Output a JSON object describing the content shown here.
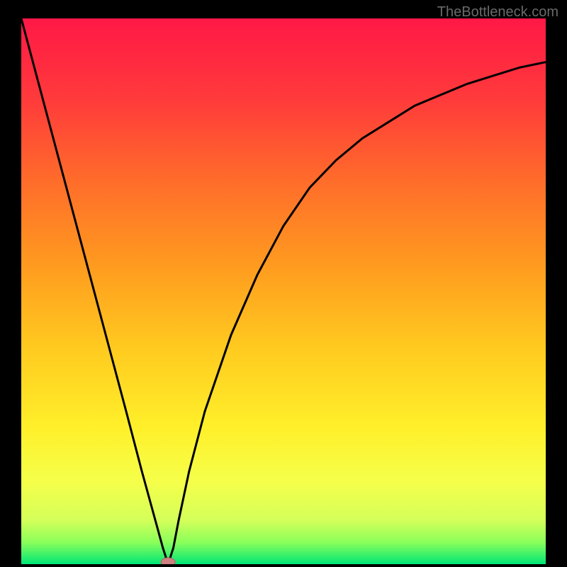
{
  "watermark": "TheBottleneck.com",
  "chart_data": {
    "type": "line",
    "title": "",
    "xlabel": "",
    "ylabel": "",
    "x_range": [
      0,
      100
    ],
    "y_range": [
      0,
      100
    ],
    "curve_points": [
      {
        "x": 0,
        "y": 100
      },
      {
        "x": 5,
        "y": 82
      },
      {
        "x": 10,
        "y": 64
      },
      {
        "x": 15,
        "y": 46
      },
      {
        "x": 20,
        "y": 28
      },
      {
        "x": 23,
        "y": 17
      },
      {
        "x": 25,
        "y": 10
      },
      {
        "x": 27,
        "y": 3
      },
      {
        "x": 28,
        "y": 0
      },
      {
        "x": 29,
        "y": 3
      },
      {
        "x": 30,
        "y": 8
      },
      {
        "x": 32,
        "y": 17
      },
      {
        "x": 35,
        "y": 28
      },
      {
        "x": 40,
        "y": 42
      },
      {
        "x": 45,
        "y": 53
      },
      {
        "x": 50,
        "y": 62
      },
      {
        "x": 55,
        "y": 69
      },
      {
        "x": 60,
        "y": 74
      },
      {
        "x": 65,
        "y": 78
      },
      {
        "x": 70,
        "y": 81
      },
      {
        "x": 75,
        "y": 84
      },
      {
        "x": 80,
        "y": 86
      },
      {
        "x": 85,
        "y": 88
      },
      {
        "x": 90,
        "y": 89.5
      },
      {
        "x": 95,
        "y": 91
      },
      {
        "x": 100,
        "y": 92
      }
    ],
    "minimum_marker": {
      "x": 28,
      "y": 0
    },
    "gradient_colors": {
      "top": "#ff1744",
      "mid_upper": "#ff5722",
      "mid": "#ffa726",
      "mid_lower": "#ffeb3b",
      "lower": "#eeff41",
      "bottom_band": "#76ff03",
      "bottom": "#00e676"
    }
  }
}
